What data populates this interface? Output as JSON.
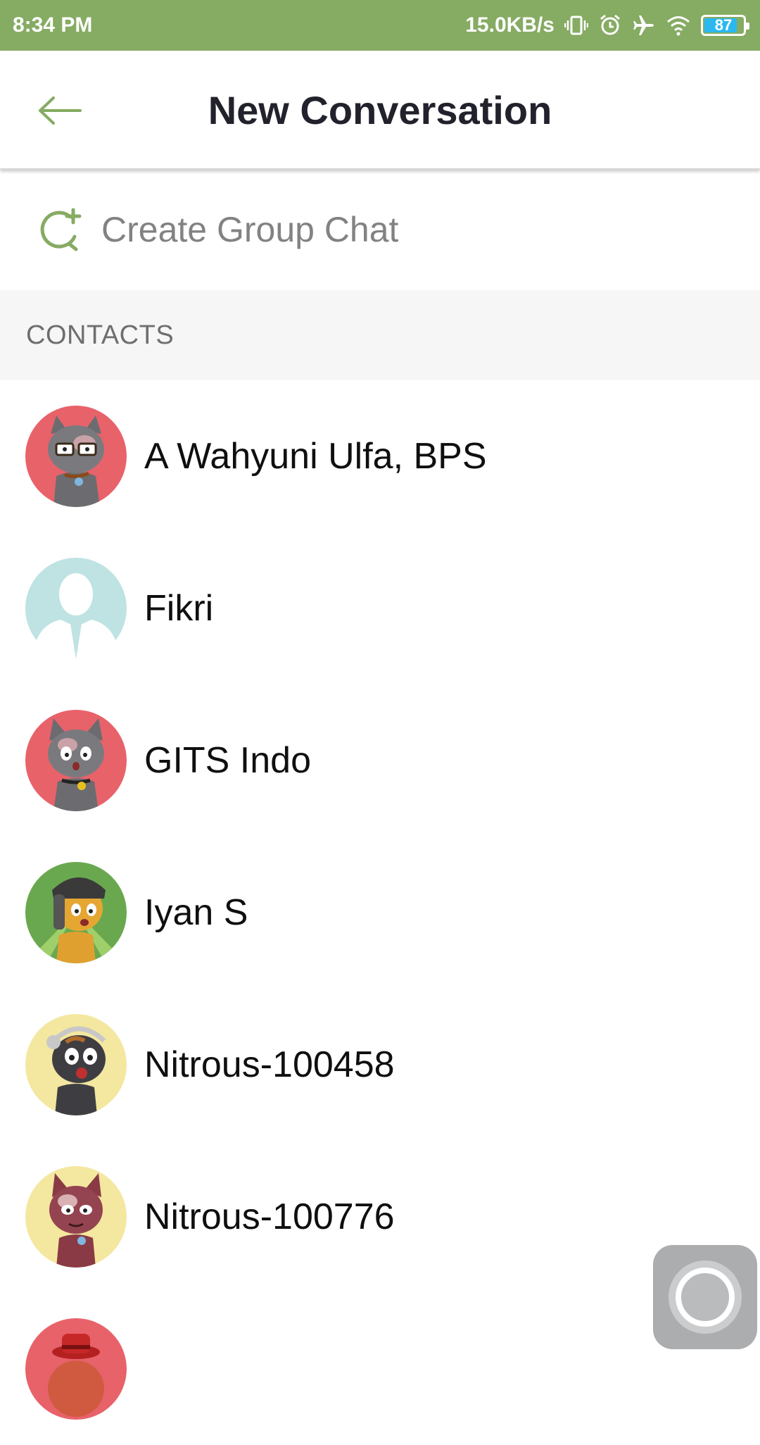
{
  "status_bar": {
    "time": "8:34 PM",
    "net_speed": "15.0KB/s",
    "battery_level": "87",
    "battery_fraction": 0.87,
    "icons": [
      "vibrate-icon",
      "alarm-icon",
      "airplane-icon",
      "wifi-icon",
      "battery-icon"
    ],
    "background_color": "#86ab63"
  },
  "header": {
    "title": "New Conversation",
    "back_icon": "arrow-left-icon",
    "accent_color": "#86ab63"
  },
  "group_chat": {
    "label": "Create Group Chat",
    "icon": "group-chat-add-icon"
  },
  "contacts_section": {
    "title": "CONTACTS"
  },
  "contacts": [
    {
      "name": "A Wahyuni Ulfa, BPS",
      "avatar": "gray-cat-glasses-avatar",
      "avatar_bg": "#e8626a"
    },
    {
      "name": "Fikri",
      "avatar": "default-person-avatar",
      "avatar_bg": "#bfe3e2"
    },
    {
      "name": "GITS Indo",
      "avatar": "gray-cat-avatar",
      "avatar_bg": "#e8626a"
    },
    {
      "name": "Iyan S",
      "avatar": "orange-cat-bandana-avatar",
      "avatar_bg": "#6aa84f"
    },
    {
      "name": "Nitrous-100458",
      "avatar": "dark-cat-headphones-avatar",
      "avatar_bg": "#f4e7a0"
    },
    {
      "name": "Nitrous-100776",
      "avatar": "red-cat-avatar",
      "avatar_bg": "#f4e7a0"
    },
    {
      "name": "",
      "avatar": "red-hat-avatar",
      "avatar_bg": "#e8626a"
    }
  ],
  "floating_button": {
    "icon": "assistive-touch-icon"
  }
}
